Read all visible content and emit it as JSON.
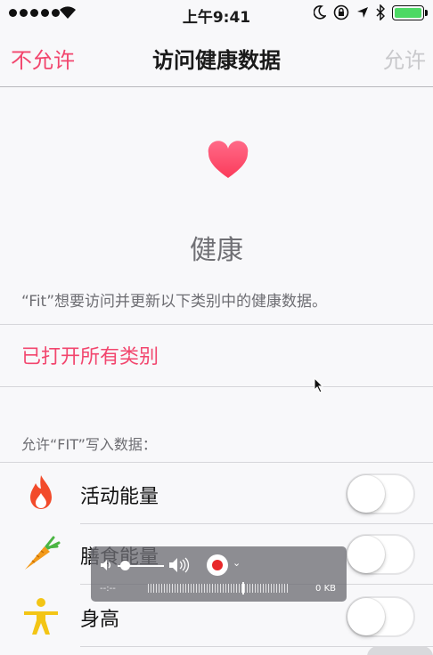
{
  "status_bar": {
    "time": "上午9:41",
    "battery_color": "#4cd964"
  },
  "nav": {
    "left_label": "不允许",
    "title": "访问健康数据",
    "right_label": "允许"
  },
  "header": {
    "app_name": "健康",
    "description": "“Fit”想要访问并更新以下类别中的健康数据。",
    "icon": "heart-icon"
  },
  "turn_on_all_label": "已打开所有类别",
  "write_section": {
    "header": "允许“FIT”写入数据：",
    "items": [
      {
        "label": "活动能量",
        "icon": "flame-icon",
        "enabled": false
      },
      {
        "label": "膳食能量",
        "icon": "carrot-icon",
        "enabled": false
      },
      {
        "label": "身高",
        "icon": "person-icon",
        "enabled": false
      }
    ]
  },
  "recorder": {
    "time": "--:--",
    "size": "0 KB"
  },
  "colors": {
    "accent": "#f2466e",
    "disabled": "#c9c9cc",
    "flame": "#f24b2b",
    "carrot": "#f39b1c",
    "person": "#f3c515"
  }
}
